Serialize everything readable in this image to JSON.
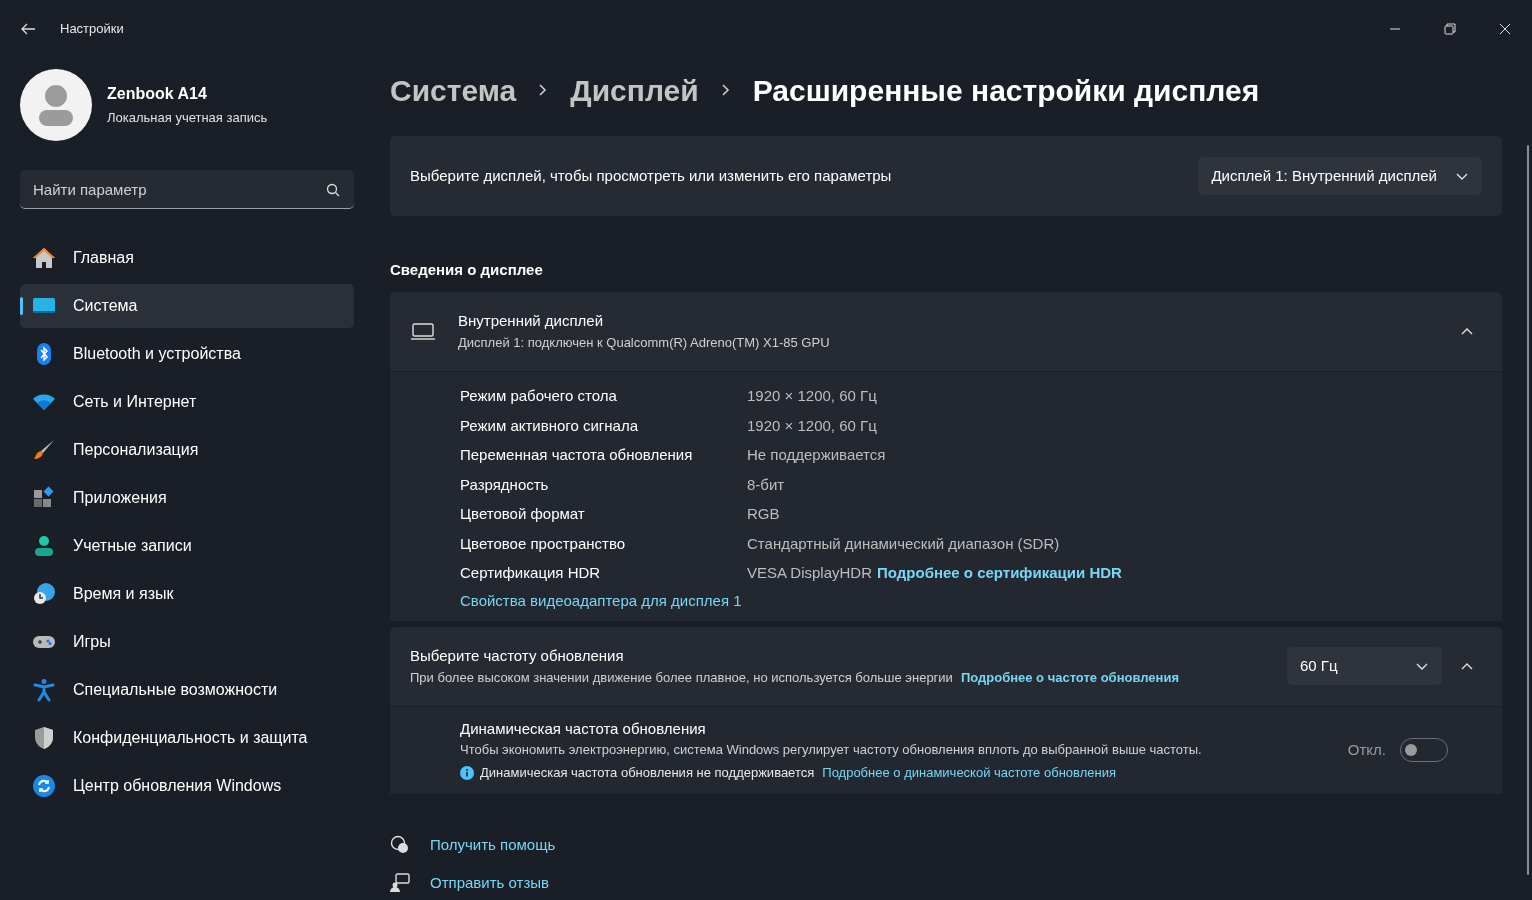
{
  "window": {
    "title": "Настройки"
  },
  "account": {
    "name": "Zenbook A14",
    "type": "Локальная учетная запись"
  },
  "search": {
    "placeholder": "Найти параметр"
  },
  "nav": [
    {
      "label": "Главная",
      "kind": "home",
      "selected": false
    },
    {
      "label": "Система",
      "kind": "system",
      "selected": true
    },
    {
      "label": "Bluetooth и устройства",
      "kind": "bluetooth",
      "selected": false
    },
    {
      "label": "Сеть и Интернет",
      "kind": "network",
      "selected": false
    },
    {
      "label": "Персонализация",
      "kind": "brush",
      "selected": false
    },
    {
      "label": "Приложения",
      "kind": "apps",
      "selected": false
    },
    {
      "label": "Учетные записи",
      "kind": "accounts",
      "selected": false
    },
    {
      "label": "Время и язык",
      "kind": "time",
      "selected": false
    },
    {
      "label": "Игры",
      "kind": "games",
      "selected": false
    },
    {
      "label": "Специальные возможности",
      "kind": "accessibility",
      "selected": false
    },
    {
      "label": "Конфиденциальность и защита",
      "kind": "privacy",
      "selected": false
    },
    {
      "label": "Центр обновления Windows",
      "kind": "update",
      "selected": false
    }
  ],
  "breadcrumb": [
    {
      "label": "Система",
      "current": false
    },
    {
      "label": "Дисплей",
      "current": false
    },
    {
      "label": "Расширенные настройки дисплея",
      "current": true
    }
  ],
  "display_select": {
    "label": "Выберите дисплей, чтобы просмотреть или изменить его параметры",
    "value": "Дисплей 1: Внутренний дисплей"
  },
  "section_title": "Сведения о дисплее",
  "display_info": {
    "title": "Внутренний дисплей",
    "subtitle": "Дисплей 1: подключен к Qualcomm(R) Adreno(TM) X1-85 GPU",
    "expanded": true,
    "rows": [
      {
        "label": "Режим рабочего стола",
        "value": "1920 × 1200, 60 Гц"
      },
      {
        "label": "Режим активного сигнала",
        "value": "1920 × 1200, 60 Гц"
      },
      {
        "label": "Переменная частота обновления",
        "value": "Не поддерживается"
      },
      {
        "label": "Разрядность",
        "value": "8-бит"
      },
      {
        "label": "Цветовой формат",
        "value": "RGB"
      },
      {
        "label": "Цветовое пространство",
        "value": "Стандартный динамический диапазон (SDR)"
      },
      {
        "label": "Сертификация HDR",
        "value": "VESA DisplayHDR",
        "link": "Подробнее о сертификации HDR"
      }
    ],
    "link": "Свойства видеоадаптера для дисплея 1"
  },
  "refresh": {
    "title": "Выберите частоту обновления",
    "description": "При более высоком значении движение более плавное, но используется больше энергии",
    "link": "Подробнее о частоте обновления",
    "value": "60 Гц",
    "expanded": true,
    "dynamic": {
      "title": "Динамическая частота обновления",
      "description": "Чтобы экономить электроэнергию, система Windows регулирует частоту обновления вплоть до выбранной выше частоты.",
      "note": "Динамическая частота обновления не поддерживается",
      "link": "Подробнее о динамической частоте обновления",
      "state_label": "Откл.",
      "on": false
    }
  },
  "footer_links": [
    {
      "label": "Получить помощь",
      "kind": "help"
    },
    {
      "label": "Отправить отзыв",
      "kind": "feedback"
    }
  ]
}
